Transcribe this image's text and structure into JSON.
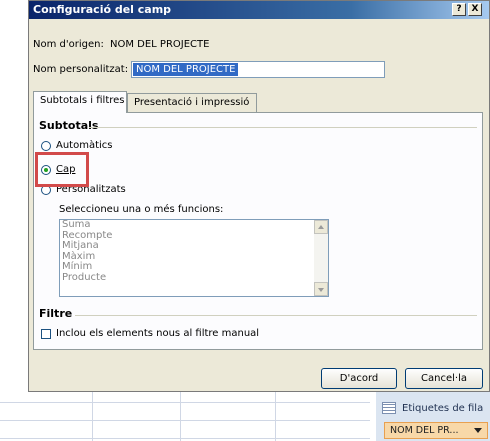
{
  "dialog": {
    "title": "Configuració del camp",
    "help_button": "?",
    "close_button": "X",
    "source_name_label": "Nom d'origen:",
    "source_name_value": "NOM DEL PROJECTE",
    "custom_name_label": "Nom personalitzat:",
    "custom_name_value": "NOM DEL PROJECTE",
    "tabs": [
      {
        "label": "Subtotals i filtres",
        "active": true
      },
      {
        "label": "Presentació i impressió",
        "active": false
      }
    ],
    "subtotals": {
      "heading": "Subtotals",
      "options": [
        {
          "label": "Automàtics",
          "selected": false
        },
        {
          "label": "Cap",
          "selected": true
        },
        {
          "label": "Personalitzats",
          "selected": false
        }
      ],
      "functions_label": "Seleccioneu una o més funcions:",
      "functions": [
        "Suma",
        "Recompte",
        "Mitjana",
        "Màxim",
        "Mínim",
        "Producte"
      ]
    },
    "filter": {
      "heading": "Filtre",
      "include_new_label": "Inclou els elements nous al filtre manual",
      "include_new_checked": false
    },
    "ok_button": "D'acord",
    "cancel_button": "Cancel·la"
  },
  "pivot_pane": {
    "row_labels": "Etiquetes de fila",
    "field": "NOM DEL PR..."
  },
  "colors": {
    "highlight": "#d24a4a",
    "title_bar": "#0a246a",
    "selection": "#316ac5"
  }
}
